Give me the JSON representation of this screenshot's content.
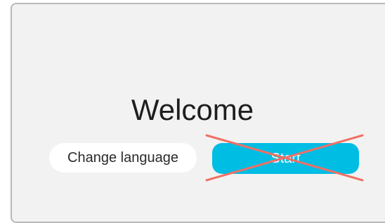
{
  "screen": {
    "title": "Welcome"
  },
  "buttons": {
    "change_language_label": "Change language",
    "start_label": "Start",
    "start_disabled_overlay": "red-cross-icon"
  },
  "colors": {
    "background": "#f2f2f2",
    "start_button": "#00bde4",
    "cross": "#f07064"
  }
}
